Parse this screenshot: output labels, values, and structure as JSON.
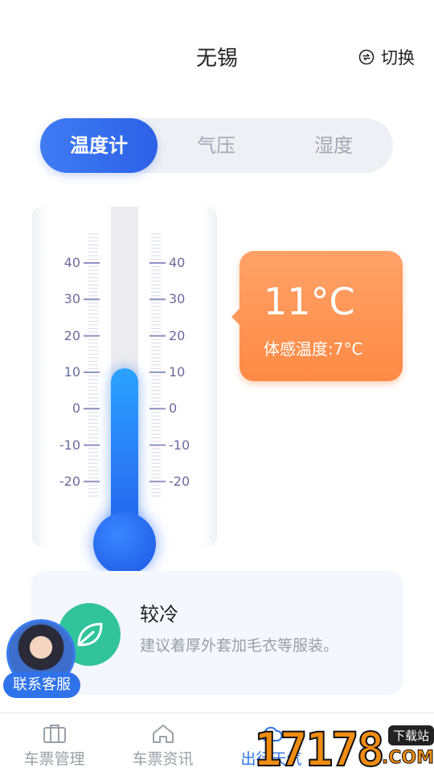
{
  "header": {
    "city": "无锡",
    "switch_label": "切换",
    "switch_icon": "switch-icon"
  },
  "tabs": [
    {
      "label": "温度计",
      "active": true
    },
    {
      "label": "气压",
      "active": false
    },
    {
      "label": "湿度",
      "active": false
    }
  ],
  "thermometer": {
    "scale": [
      "40",
      "30",
      "20",
      "10",
      "0",
      "-10",
      "-20"
    ],
    "current_value": 11,
    "range": [
      -20,
      40
    ]
  },
  "reading": {
    "temperature": "11°C",
    "feels_like": "体感温度:7°C"
  },
  "tip": {
    "title": "较冷",
    "description": "建议着厚外套加毛衣等服装。",
    "icon": "leaf-icon"
  },
  "service": {
    "label": "联系客服"
  },
  "tabbar": [
    {
      "label": "车票管理",
      "icon": "suitcase-icon",
      "active": false
    },
    {
      "label": "车票资讯",
      "icon": "home-icon",
      "active": false
    },
    {
      "label": "出行天气",
      "icon": "weather-icon",
      "active": true
    }
  ],
  "watermark": {
    "digits": "17178",
    "badge": "下载站",
    "domain": ".COM"
  },
  "colors": {
    "accent": "#2f73ea",
    "bubble": "#ff9152",
    "leaf": "#31c49a"
  }
}
